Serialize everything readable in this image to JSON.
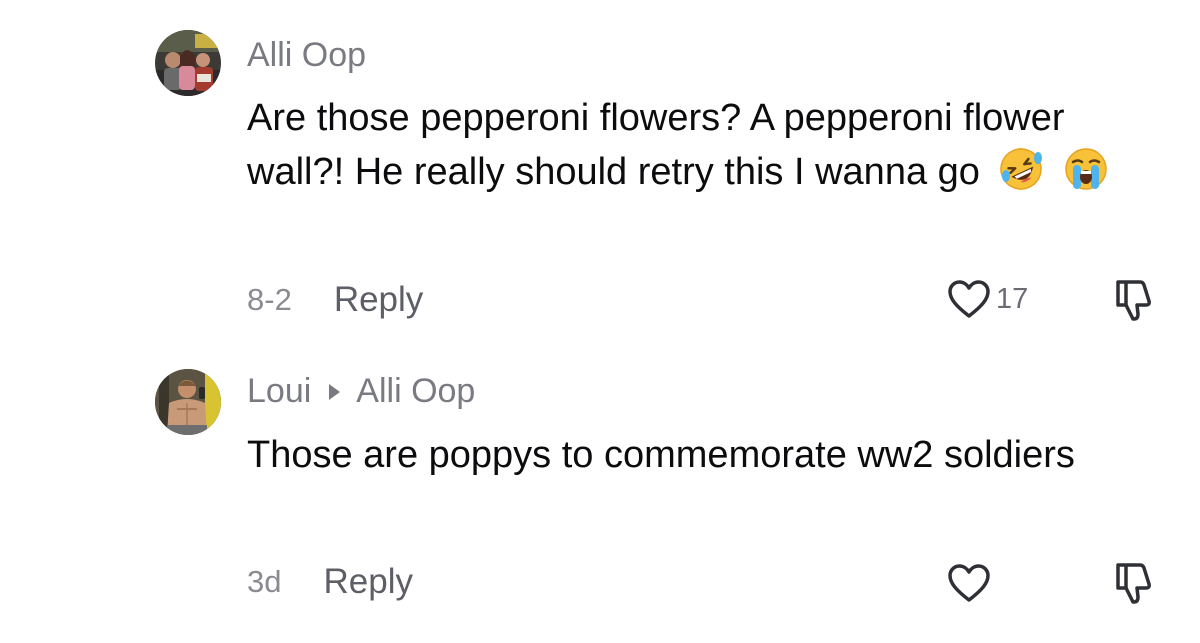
{
  "comments": [
    {
      "username": "Alli Oop",
      "reply_to": "",
      "text": "Are those pepperoni flowers? A pepperoni flower wall?! He really should retry this I wanna go",
      "emojis": [
        "rolling-on-floor-laughing-emoji",
        "loudly-crying-emoji"
      ],
      "date": "8-2",
      "reply_label": "Reply",
      "like_count": "17"
    },
    {
      "username": "Loui",
      "reply_to": "Alli Oop",
      "text": "Those are poppys to commemorate ww2 soldiers",
      "emojis": [],
      "date": "3d",
      "reply_label": "Reply",
      "like_count": ""
    }
  ],
  "colors": {
    "text": "#0c0c0e",
    "secondary": "#7a7b82",
    "icon": "#2f3035"
  },
  "icons": {
    "like": "heart-outline-icon",
    "dislike": "thumbs-down-outline-icon",
    "reply_indicator": "triangle-right-icon"
  }
}
